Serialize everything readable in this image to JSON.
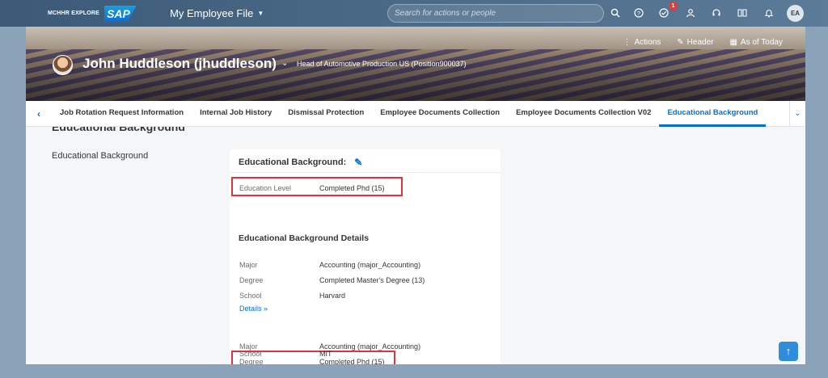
{
  "shell": {
    "brand": "MCHHR EXPLORE",
    "logo": "SAP",
    "app_title": "My Employee File",
    "search_placeholder": "Search for actions or people",
    "notification_count": "1",
    "user_initials": "EA",
    "icons": [
      "search-icon",
      "help-icon",
      "todo-icon",
      "people-icon",
      "headset-icon",
      "book-icon",
      "bell-icon"
    ]
  },
  "header": {
    "person_name": "John Huddleson (jhuddleson)",
    "position": "Head of Automotive Production US (Position900037)",
    "actions_label": "Actions",
    "header_label": "Header",
    "as_of_label": "As of Today"
  },
  "tabs": [
    {
      "label": "Job Rotation Request Information",
      "active": false
    },
    {
      "label": "Internal Job History",
      "active": false
    },
    {
      "label": "Dismissal Protection",
      "active": false
    },
    {
      "label": "Employee Documents Collection",
      "active": false
    },
    {
      "label": "Employee Documents Collection V02",
      "active": false
    },
    {
      "label": "Educational Background",
      "active": true
    }
  ],
  "content": {
    "clipped_heading": "Educational Background",
    "section_label": "Educational Background",
    "card": {
      "title": "Educational Background:",
      "education_level": {
        "label": "Education Level",
        "value": "Completed Phd (15)"
      },
      "details_heading": "Educational Background Details",
      "entries": [
        {
          "major": {
            "label": "Major",
            "value": "Accounting (major_Accounting)"
          },
          "degree": {
            "label": "Degree",
            "value": "Completed Master's Degree (13)"
          },
          "school": {
            "label": "School",
            "value": "Harvard"
          }
        },
        {
          "major": {
            "label": "Major",
            "value": "Accounting (major_Accounting)"
          },
          "degree": {
            "label": "Degree",
            "value": "Completed Phd (15)"
          },
          "school": {
            "label": "School",
            "value": "MIT"
          }
        }
      ],
      "details_link": "Details"
    }
  },
  "colors": {
    "accent": "#0a6ed1",
    "highlight": "#d9363e",
    "shell": "#4a6a88"
  }
}
